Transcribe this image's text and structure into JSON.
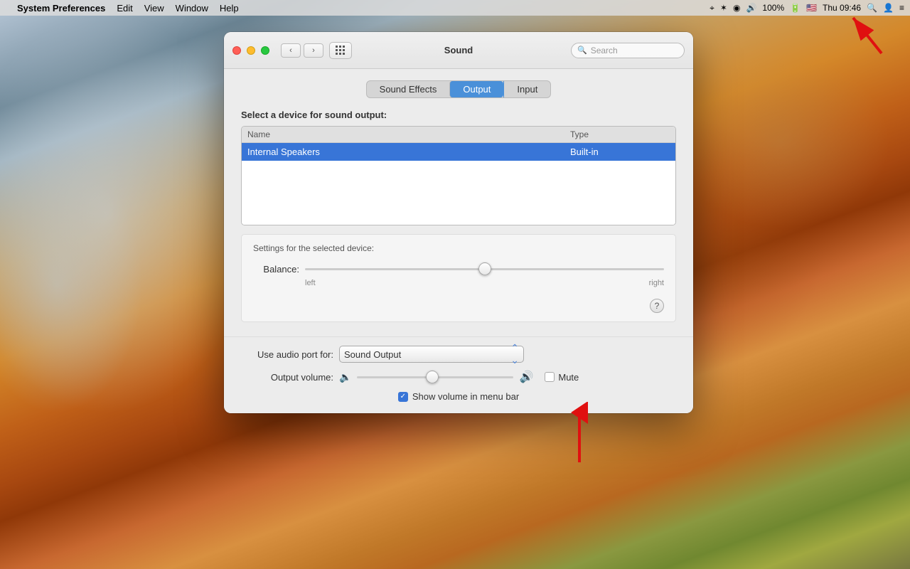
{
  "desktop": {},
  "menubar": {
    "apple": "",
    "appName": "System Preferences",
    "items": [
      "Edit",
      "View",
      "Window",
      "Help"
    ],
    "rightItems": {
      "battery": "100%",
      "time": "Thu 09:46"
    }
  },
  "window": {
    "title": "Sound",
    "search": {
      "placeholder": "Search"
    },
    "tabs": [
      {
        "label": "Sound Effects",
        "active": false
      },
      {
        "label": "Output",
        "active": true
      },
      {
        "label": "Input",
        "active": false
      }
    ],
    "outputSection": {
      "label": "Select a device for sound output:",
      "columns": [
        {
          "label": "Name"
        },
        {
          "label": "Type"
        }
      ],
      "rows": [
        {
          "name": "Internal Speakers",
          "type": "Built-in",
          "selected": true
        }
      ]
    },
    "settingsSection": {
      "label": "Settings for the selected device:",
      "balance": {
        "label": "Balance:",
        "leftLabel": "left",
        "rightLabel": "right",
        "value": 50
      },
      "helpButton": "?"
    },
    "bottomSection": {
      "audioPortLabel": "Use audio port for:",
      "audioPortValue": "Sound Output",
      "outputVolumeLabel": "Output volume:",
      "volumeValue": 48,
      "muteLabel": "Mute",
      "showVolumeLabel": "Show volume in menu bar"
    }
  }
}
